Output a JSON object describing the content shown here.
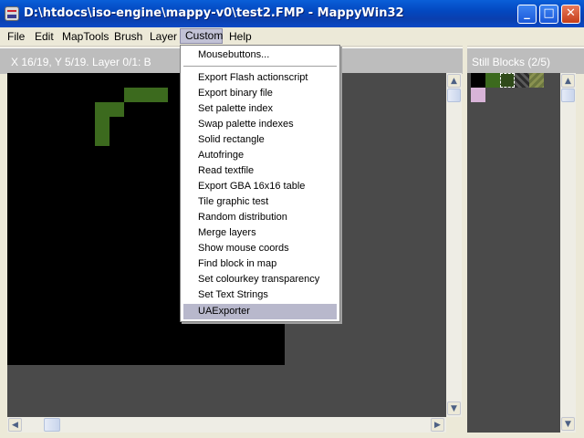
{
  "window": {
    "title": "D:\\htdocs\\iso-engine\\mappy-v0\\test2.FMP - MappyWin32",
    "app_icon": "mappy-app-icon",
    "buttons": {
      "minimize": "_",
      "maximize": "□",
      "close": "✕"
    }
  },
  "menubar": [
    {
      "label": "File"
    },
    {
      "label": "Edit"
    },
    {
      "label": "MapTools"
    },
    {
      "label": "Brush"
    },
    {
      "label": "Layer"
    },
    {
      "label": "Custom"
    },
    {
      "label": "Help"
    }
  ],
  "map_panel": {
    "header": "X 16/19, Y 5/19. Layer 0/1: B"
  },
  "blocks_panel": {
    "header": "Still Blocks (2/5)"
  },
  "custom_menu": {
    "items": [
      "Mousebuttons...",
      "Export Flash actionscript",
      "Export binary file",
      "Set palette index",
      "Swap palette indexes",
      "Solid rectangle",
      "Autofringe",
      "Read textfile",
      "Export GBA 16x16 table",
      "Tile graphic test",
      "Random distribution",
      "Merge layers",
      "Show mouse coords",
      "Find block in map",
      "Set colourkey transparency",
      "Set Text Strings",
      "UAExporter"
    ],
    "selected": "UAExporter"
  },
  "scroll_icons": {
    "up": "▲",
    "down": "▼",
    "left": "◀",
    "right": "▶"
  },
  "colors": {
    "titlebar": "#0a4fc9",
    "tile_green": "#3c6a1e",
    "canvas_bg": "#4a4a4a",
    "menu_highlight": "#b8b8cc"
  }
}
